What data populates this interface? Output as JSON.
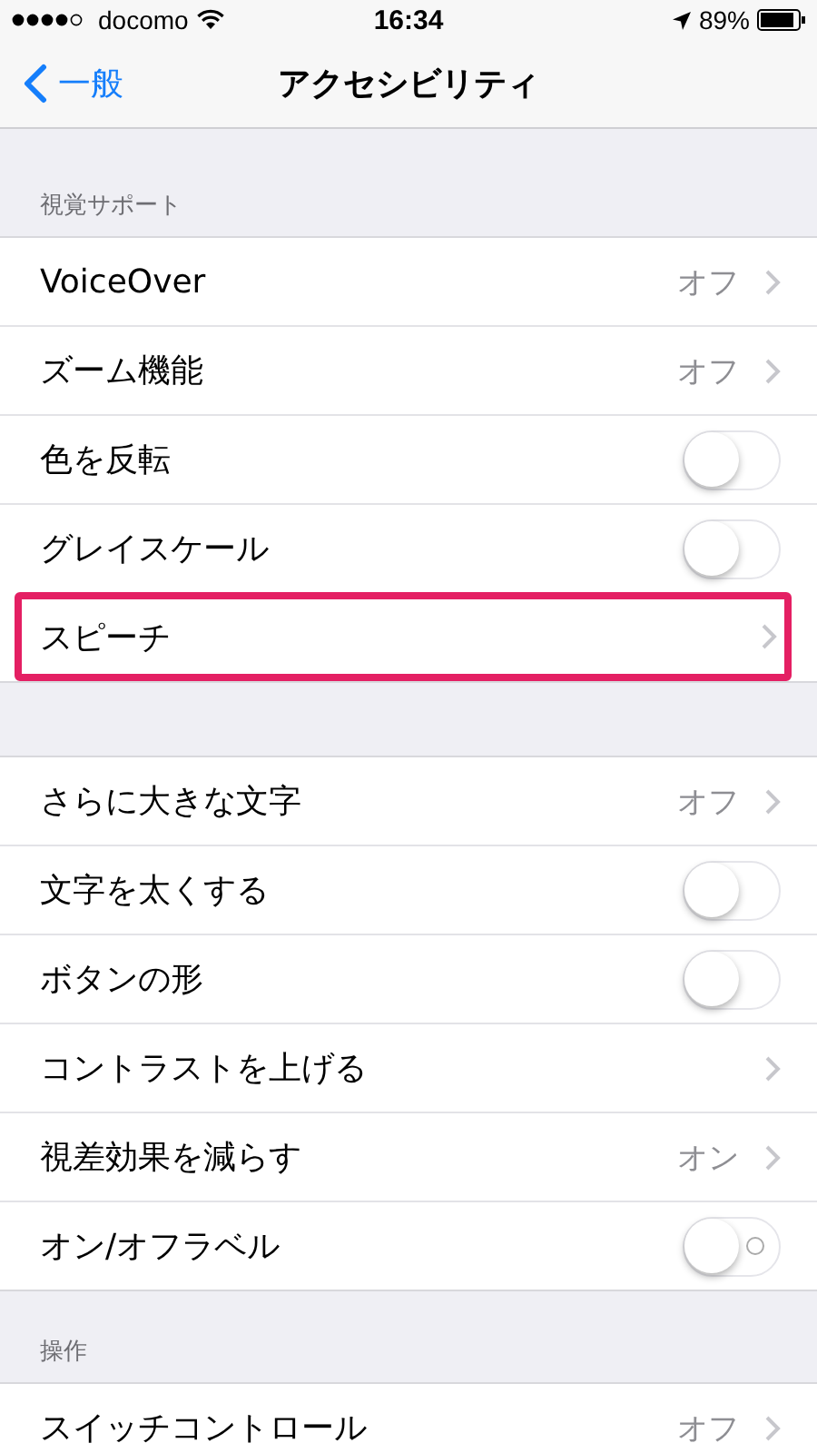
{
  "status_bar": {
    "carrier": "docomo",
    "time": "16:34",
    "battery": "89%"
  },
  "nav": {
    "back": "一般",
    "title": "アクセシビリティ"
  },
  "sections": [
    {
      "header": "視覚サポート",
      "rows": [
        {
          "kind": "detail",
          "label": "VoiceOver",
          "value": "オフ",
          "highlighted": false
        },
        {
          "kind": "detail",
          "label": "ズーム機能",
          "value": "オフ",
          "highlighted": false
        },
        {
          "kind": "toggle",
          "label": "色を反転",
          "on": false,
          "show_label": false,
          "highlighted": false
        },
        {
          "kind": "toggle",
          "label": "グレイスケール",
          "on": false,
          "show_label": false,
          "highlighted": false
        },
        {
          "kind": "detail",
          "label": "スピーチ",
          "highlighted": true
        }
      ]
    },
    {
      "rows": [
        {
          "kind": "detail",
          "label": "さらに大きな文字",
          "value": "オフ",
          "highlighted": false
        },
        {
          "kind": "toggle",
          "label": "文字を太くする",
          "on": false,
          "show_label": false,
          "highlighted": false
        },
        {
          "kind": "toggle",
          "label": "ボタンの形",
          "on": false,
          "show_label": false,
          "highlighted": false
        },
        {
          "kind": "detail",
          "label": "コントラストを上げる",
          "highlighted": false
        },
        {
          "kind": "detail",
          "label": "視差効果を減らす",
          "value": "オン",
          "highlighted": false
        },
        {
          "kind": "toggle",
          "label": "オン/オフラベル",
          "on": false,
          "show_label": true,
          "highlighted": false
        }
      ]
    },
    {
      "header": "操作",
      "rows": [
        {
          "kind": "detail",
          "label": "スイッチコントロール",
          "value": "オフ",
          "highlighted": false
        }
      ]
    }
  ]
}
